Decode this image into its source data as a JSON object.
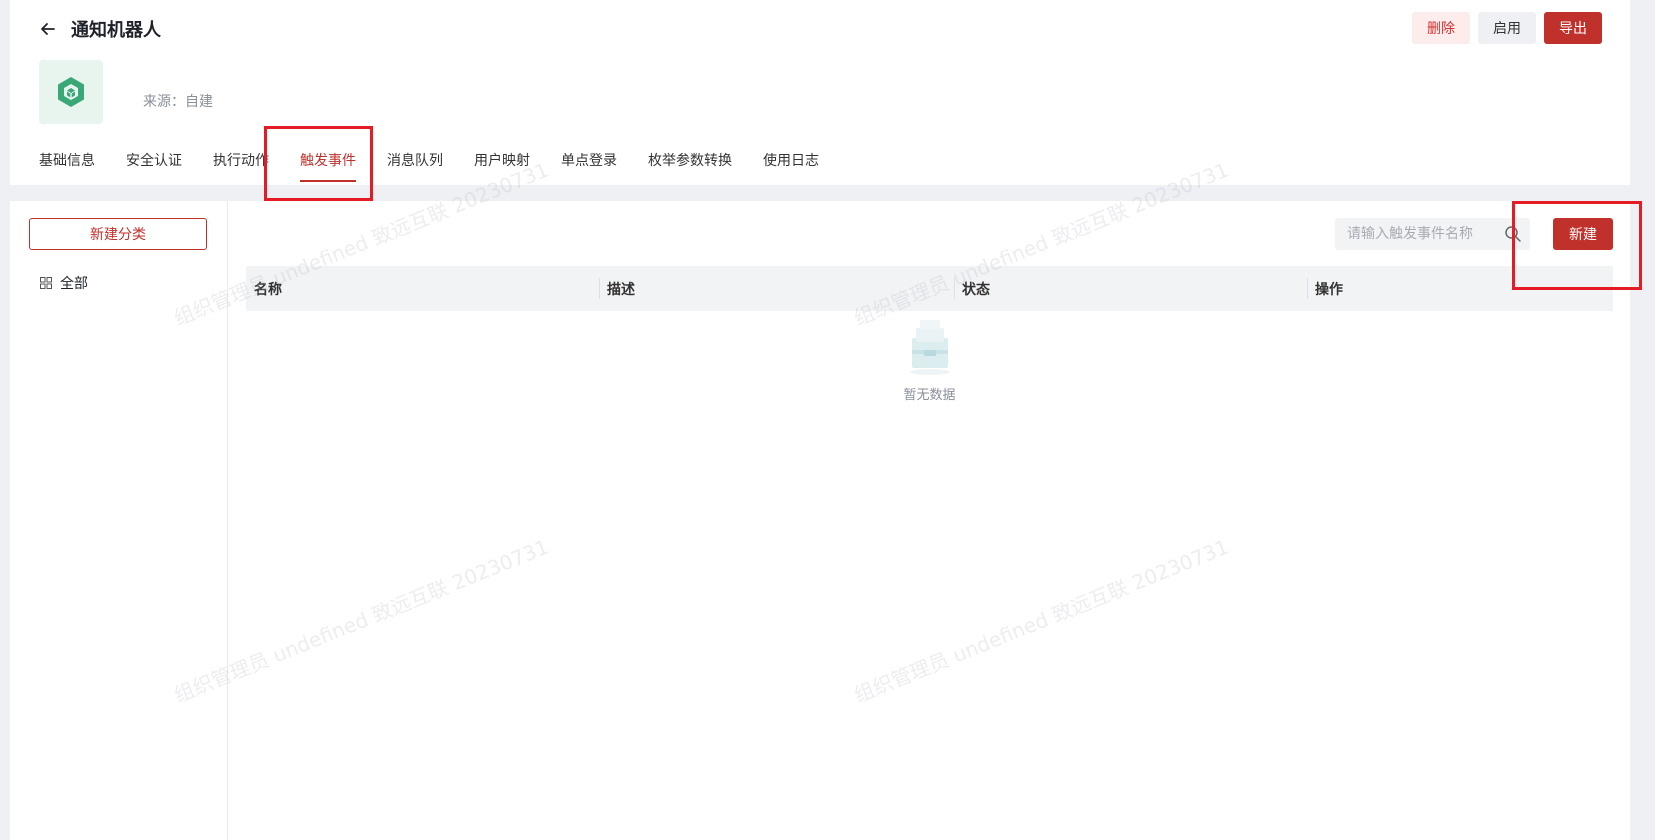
{
  "header": {
    "title": "通知机器人",
    "source": "来源：自建",
    "actions": {
      "delete_label": "删除",
      "enable_label": "启用",
      "export_label": "导出"
    }
  },
  "tabs": [
    {
      "label": "基础信息"
    },
    {
      "label": "安全认证"
    },
    {
      "label": "执行动作"
    },
    {
      "label": "触发事件",
      "active": true
    },
    {
      "label": "消息队列"
    },
    {
      "label": "用户映射"
    },
    {
      "label": "单点登录"
    },
    {
      "label": "枚举参数转换"
    },
    {
      "label": "使用日志"
    }
  ],
  "sidebar": {
    "new_category_label": "新建分类",
    "items": [
      {
        "label": "全部",
        "icon": "grid-icon"
      }
    ]
  },
  "toolbar": {
    "search_placeholder": "请输入触发事件名称",
    "new_label": "新建"
  },
  "table": {
    "columns": [
      "名称",
      "描述",
      "状态",
      "操作"
    ],
    "rows": [],
    "empty_text": "暂无数据"
  },
  "watermark": "组织管理员 undefined 致远互联 20230731",
  "colors": {
    "primary": "#c0312b",
    "highlight": "#e51c23",
    "logo_green": "#3aa876"
  }
}
